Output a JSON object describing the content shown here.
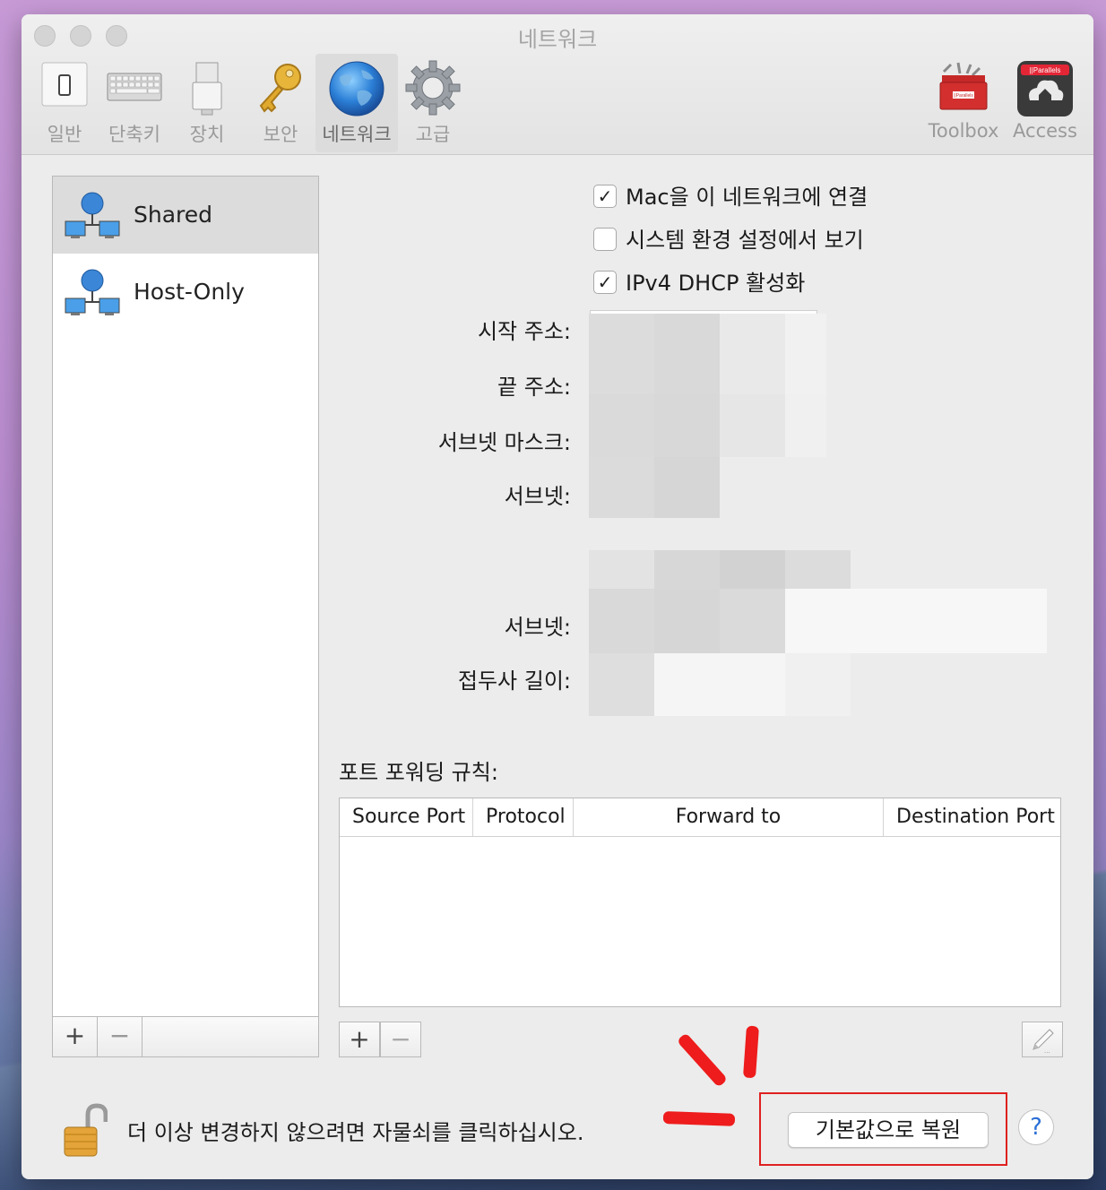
{
  "window": {
    "title": "네트워크"
  },
  "toolbar": {
    "tabs": [
      {
        "label": "일반",
        "icon": "device-icon"
      },
      {
        "label": "단축키",
        "icon": "keyboard-icon"
      },
      {
        "label": "장치",
        "icon": "usb-icon"
      },
      {
        "label": "보안",
        "icon": "key-icon"
      },
      {
        "label": "네트워크",
        "icon": "globe-icon",
        "active": true
      },
      {
        "label": "고급",
        "icon": "gear-icon"
      }
    ],
    "right": [
      {
        "label": "Toolbox",
        "icon": "toolbox-icon",
        "badge": "||Parallels"
      },
      {
        "label": "Access",
        "icon": "access-icon",
        "badge": "||Parallels"
      }
    ]
  },
  "sidebar": {
    "items": [
      {
        "label": "Shared",
        "selected": true
      },
      {
        "label": "Host-Only",
        "selected": false
      }
    ],
    "add_label": "+",
    "remove_label": "−"
  },
  "options": {
    "connect_mac": {
      "label": "Mac을 이 네트워크에 연결",
      "checked": true
    },
    "show_in_prefs": {
      "label": "시스템 환경 설정에서 보기",
      "checked": false
    },
    "ipv4_dhcp": {
      "label": "IPv4 DHCP 활성화",
      "checked": true
    }
  },
  "fields": {
    "start_address": "시작 주소:",
    "end_address": "끝 주소:",
    "subnet_mask": "서브넷 마스크:",
    "subnet": "서브넷:",
    "subnet2": "서브넷:",
    "prefix_length": "접두사 길이:"
  },
  "port_forwarding": {
    "title": "포트 포워딩 규칙:",
    "columns": [
      "Source Port",
      "Protocol",
      "Forward to",
      "Destination Port"
    ],
    "rows": [],
    "add_label": "+",
    "remove_label": "−"
  },
  "footer": {
    "lock_text": "더 이상 변경하지 않으려면 자물쇠를 클릭하십시오.",
    "restore_label": "기본값으로 복원",
    "help_label": "?"
  },
  "colors": {
    "annotation_red": "#ee1c1c",
    "help_blue": "#2b6fd6"
  }
}
